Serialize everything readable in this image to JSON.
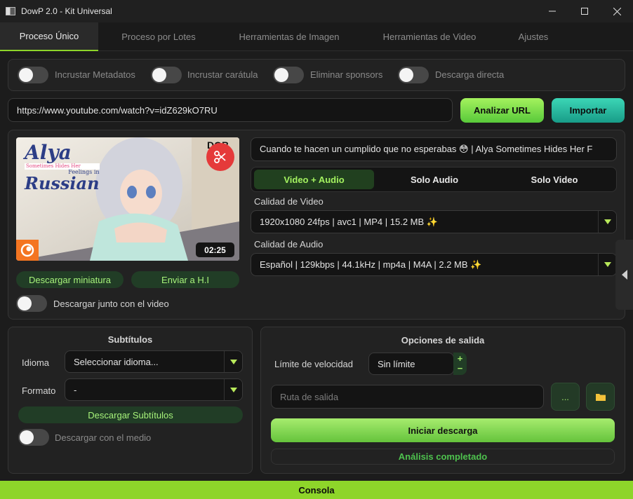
{
  "window": {
    "title": "DowP 2.0 - Kit Universal"
  },
  "tabs": [
    {
      "label": "Proceso Único"
    },
    {
      "label": "Proceso por Lotes"
    },
    {
      "label": "Herramientas de Imagen"
    },
    {
      "label": "Herramientas de Video"
    },
    {
      "label": "Ajustes"
    }
  ],
  "options": {
    "metadata": "Incrustar Metadatos",
    "cover": "Incrustar carátula",
    "sponsors": "Eliminar sponsors",
    "direct": "Descarga directa"
  },
  "url": {
    "value": "https://www.youtube.com/watch?v=idZ629kO7RU",
    "analyze_label": "Analizar URL",
    "import_label": "Importar"
  },
  "thumbnail": {
    "duration": "02:25",
    "badge_text": "DOB",
    "logo_lines": [
      "Alya",
      "Sometimes Hides Her",
      "Feelings in",
      "Russian"
    ],
    "download_thumb_label": "Descargar miniatura",
    "send_label": "Enviar a H.I",
    "with_video_label": "Descargar junto con el video"
  },
  "media": {
    "title": "Cuando te hacen un cumplido que no esperabas 😳 | Alya Sometimes Hides Her F",
    "modes": [
      "Video + Audio",
      "Solo Audio",
      "Solo Video"
    ],
    "video_quality_label": "Calidad de Video",
    "video_quality": "1920x1080 24fps | avc1 | MP4 | 15.2 MB ✨",
    "audio_quality_label": "Calidad de Audio",
    "audio_quality": "Español | 129kbps | 44.1kHz | mp4a | M4A | 2.2 MB ✨"
  },
  "subtitles": {
    "heading": "Subtítulos",
    "language_label": "Idioma",
    "language_value": "Seleccionar idioma...",
    "format_label": "Formato",
    "format_value": "-",
    "download_label": "Descargar Subtítulos",
    "with_media_label": "Descargar con el medio"
  },
  "output": {
    "heading": "Opciones de salida",
    "speed_label": "Límite de velocidad",
    "speed_value": "Sin límite",
    "path_placeholder": "Ruta de salida",
    "dots_label": "...",
    "start_label": "Iniciar descarga",
    "status": "Análisis completado"
  },
  "console": {
    "label": "Consola"
  },
  "colors": {
    "accent": "#8ed52a",
    "button_green": "#58c93a",
    "button_teal": "#189c88",
    "status_green": "#4ec24e",
    "scissors_red": "#e53a3a"
  }
}
